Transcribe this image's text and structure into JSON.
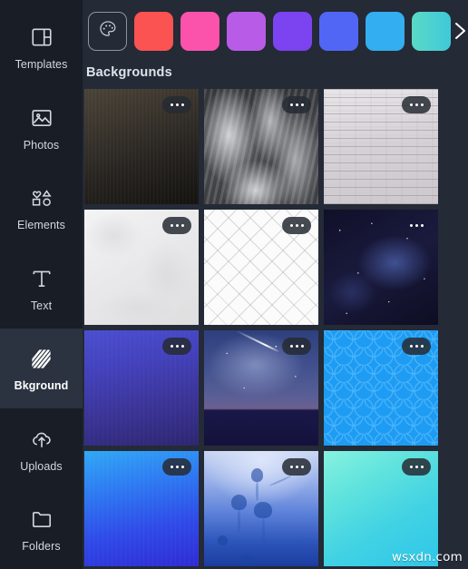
{
  "sidebar": {
    "items": [
      {
        "label": "Templates",
        "icon": "templates-icon",
        "active": false
      },
      {
        "label": "Photos",
        "icon": "photos-icon",
        "active": false
      },
      {
        "label": "Elements",
        "icon": "elements-icon",
        "active": false
      },
      {
        "label": "Text",
        "icon": "text-icon",
        "active": false
      },
      {
        "label": "Bkground",
        "icon": "background-icon",
        "active": true
      },
      {
        "label": "Uploads",
        "icon": "uploads-icon",
        "active": false
      },
      {
        "label": "Folders",
        "icon": "folders-icon",
        "active": false
      }
    ]
  },
  "panel": {
    "swatches": [
      {
        "name": "color-picker",
        "icon": "palette-icon",
        "color": ""
      },
      {
        "name": "swatch-red",
        "color": "#FB5252"
      },
      {
        "name": "swatch-pink",
        "color": "#FB52AC"
      },
      {
        "name": "swatch-orchid",
        "color": "#B85CE8"
      },
      {
        "name": "swatch-violet",
        "color": "#7C43F0"
      },
      {
        "name": "swatch-blue",
        "color": "#5266F5"
      },
      {
        "name": "swatch-cyan",
        "color": "#33AEF0"
      },
      {
        "name": "swatch-teal",
        "color": "#5AD9C5"
      }
    ],
    "strip_arrow_icon": "chevron-right-icon",
    "section_title": "Backgrounds",
    "more_label": "•••",
    "thumbnails": [
      {
        "name": "bg-dark-brown-gradient",
        "texture": "t-dark-gradient",
        "more": true
      },
      {
        "name": "bg-grey-stone-texture",
        "texture": "t-grey-texture",
        "more": true
      },
      {
        "name": "bg-white-wood-planks",
        "texture": "t-white-wood",
        "more": true
      },
      {
        "name": "bg-white-marble",
        "texture": "t-white-marble",
        "more": true
      },
      {
        "name": "bg-white-quilted",
        "texture": "t-quilt",
        "more": true
      },
      {
        "name": "bg-dark-starfield",
        "texture": "t-starfield",
        "more": true
      },
      {
        "name": "bg-indigo-gradient",
        "texture": "t-indigo-gradient",
        "more": true
      },
      {
        "name": "bg-night-sky-meteor",
        "texture": "t-night-sky",
        "more": true
      },
      {
        "name": "bg-blue-hexagons",
        "texture": "t-hex",
        "more": true
      },
      {
        "name": "bg-blue-gradient",
        "texture": "t-blue-gradient",
        "more": true
      },
      {
        "name": "bg-jellyfish-underwater",
        "texture": "t-jellyfish",
        "more": true
      },
      {
        "name": "bg-teal-gradient",
        "texture": "t-teal-gradient",
        "more": true
      }
    ]
  },
  "watermark": {
    "text": "wsxdn.com"
  }
}
